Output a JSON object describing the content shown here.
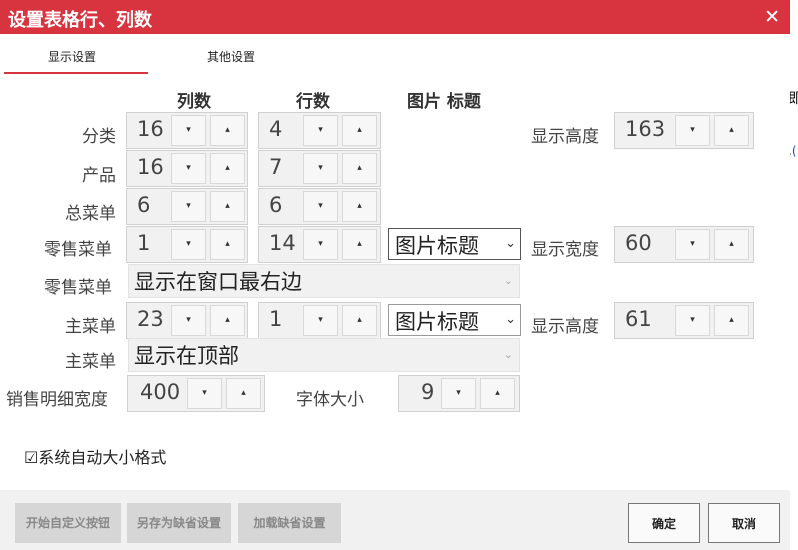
{
  "window": {
    "title": "设置表格行、列数",
    "close_glyph": "✕"
  },
  "tabs": [
    {
      "label": "显示设置"
    },
    {
      "label": "其他设置"
    }
  ],
  "edge_glyphs": [
    "即",
    ".("
  ],
  "headers": {
    "cols": "列数",
    "rows": "行数",
    "picture_title": "图片 标题"
  },
  "rows": {
    "category": {
      "label": "分类",
      "cols": "16",
      "rows": "4"
    },
    "product": {
      "label": "产品",
      "cols": "16",
      "rows": "7"
    },
    "master_menu": {
      "label": "总菜单",
      "cols": "6",
      "rows": "6"
    },
    "retail_menu": {
      "label": "零售菜单",
      "cols": "1",
      "rows": "14",
      "picture_option": "图片标题"
    },
    "retail_menu_pos": {
      "label": "零售菜单",
      "value": "显示在窗口最右边"
    },
    "main_menu": {
      "label": "主菜单",
      "cols": "23",
      "rows": "1",
      "picture_option": "图片标题"
    },
    "main_menu_pos": {
      "label": "主菜单",
      "value": "显示在顶部"
    },
    "sales_detail": {
      "label": "销售明细宽度",
      "value": "400"
    },
    "font_size": {
      "label": "字体大小",
      "value": "9"
    }
  },
  "display": {
    "height1": {
      "label": "显示高度",
      "value": "163"
    },
    "width": {
      "label": "显示宽度",
      "value": "60"
    },
    "height2": {
      "label": "显示高度",
      "value": "61"
    }
  },
  "spin_glyphs": {
    "down": "▾",
    "up": "▴"
  },
  "select_arrow": "⌄",
  "auto_format": {
    "checked": true,
    "box": "☑",
    "label": "系统自动大小格式"
  },
  "footer": {
    "custom_button": "开始自定义按钮",
    "save_default": "另存为缺省设置",
    "load_default": "加载缺省设置",
    "ok": "确定",
    "cancel": "取消"
  },
  "colors": {
    "title_bar": "#d8343f",
    "tab_underline": "#d8343f",
    "footer": "#f1f1f1"
  }
}
